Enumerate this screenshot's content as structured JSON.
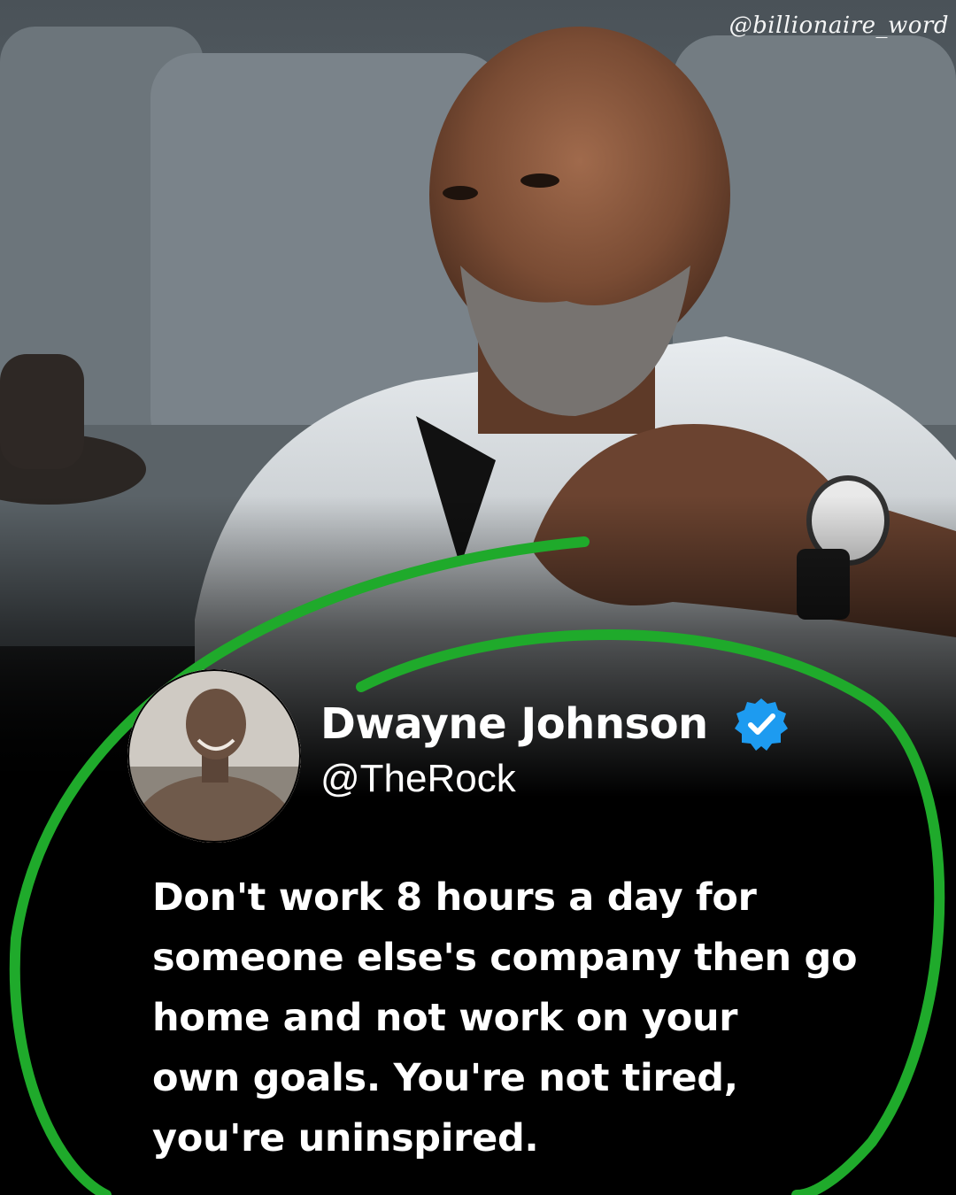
{
  "watermark": "@billionaire_word",
  "post": {
    "author_name": "Dwayne Johnson",
    "handle": "@TheRock",
    "verified": true,
    "text_lines": [
      "Don't work 8 hours a day for",
      "someone else's company then go",
      "home and not work on your",
      "own goals. You're not tired,",
      "you're uninspired."
    ]
  },
  "icons": {
    "verified": "verified-badge-icon"
  },
  "colors": {
    "background": "#000000",
    "accent_green": "#1faa2b",
    "verified_blue": "#1d9bf0",
    "text": "#ffffff"
  }
}
